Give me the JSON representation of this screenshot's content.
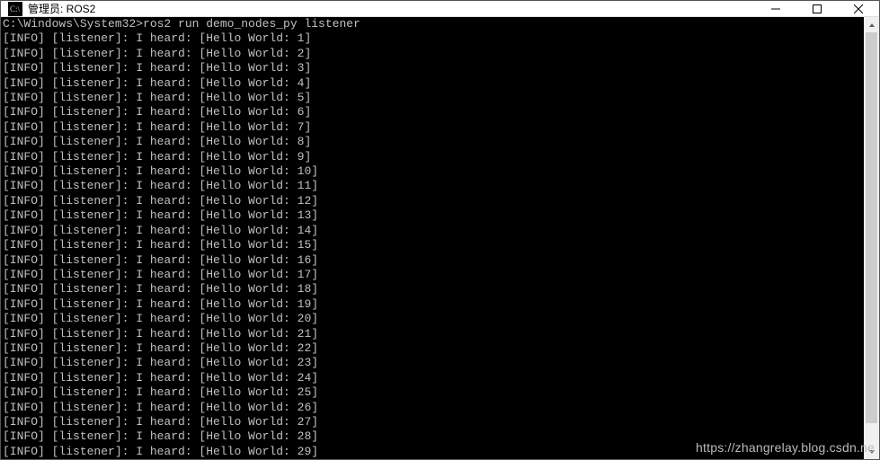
{
  "window": {
    "title": "管理员: ROS2"
  },
  "terminal": {
    "prompt": "C:\\Windows\\System32>",
    "command": "ros2 run demo_nodes_py listener",
    "log_prefix": "[INFO] [listener]: I heard: [Hello World: ",
    "log_suffix": "]",
    "lines": [
      1,
      2,
      3,
      4,
      5,
      6,
      7,
      8,
      9,
      10,
      11,
      12,
      13,
      14,
      15,
      16,
      17,
      18,
      19,
      20,
      21,
      22,
      23,
      24,
      25,
      26,
      27,
      28,
      29
    ]
  },
  "watermark": "https://zhangrelay.blog.csdn.ne"
}
